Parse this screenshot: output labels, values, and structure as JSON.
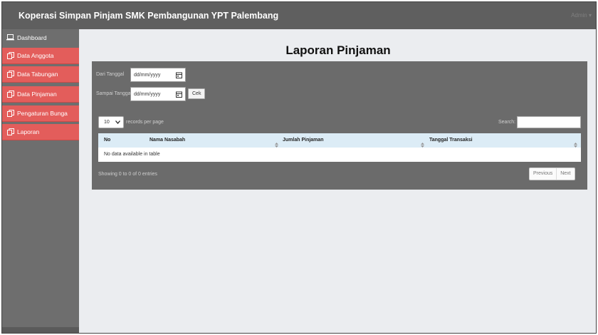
{
  "app": {
    "title": "Koperasi Simpan Pinjam SMK Pembangunan YPT Palembang",
    "user_menu": "Admin ▾"
  },
  "sidebar": {
    "items": [
      {
        "label": "Dashboard",
        "icon": "laptop-icon",
        "style": "plain"
      },
      {
        "label": "Data Anggota",
        "icon": "copy-icon",
        "style": "red"
      },
      {
        "label": "Data Tabungan",
        "icon": "copy-icon",
        "style": "red"
      },
      {
        "label": "Data Pinjaman",
        "icon": "copy-icon",
        "style": "red"
      },
      {
        "label": "Pengaturan Bunga",
        "icon": "copy-icon",
        "style": "red"
      },
      {
        "label": "Laporan",
        "icon": "copy-icon",
        "style": "red"
      }
    ]
  },
  "main": {
    "title": "Laporan Pinjaman",
    "filter": {
      "from_label": "Dari Tanggal",
      "to_label": "Sampai Tanggal",
      "from_value": "dd/mm/yyyy",
      "to_value": "dd/mm/yyyy",
      "check_button": "Cek"
    },
    "table_controls": {
      "length_value": "10",
      "length_suffix": "records per page",
      "search_label": "Search:"
    },
    "table": {
      "columns": [
        "No",
        "Nama Nasabah",
        "Jumlah Pinjaman",
        "Tanggal Transaksi"
      ],
      "empty_message": "No data available in table"
    },
    "footer": {
      "info": "Showing 0 to 0 of 0 entries",
      "previous": "Previous",
      "next": "Next"
    }
  },
  "colors": {
    "topbar": "#5f5f5f",
    "sidebar": "#6e6e6e",
    "menu_accent": "#e35d5b",
    "panel": "#6b6b6b",
    "table_header": "#dcecf6",
    "page_background": "#ebedf0"
  }
}
